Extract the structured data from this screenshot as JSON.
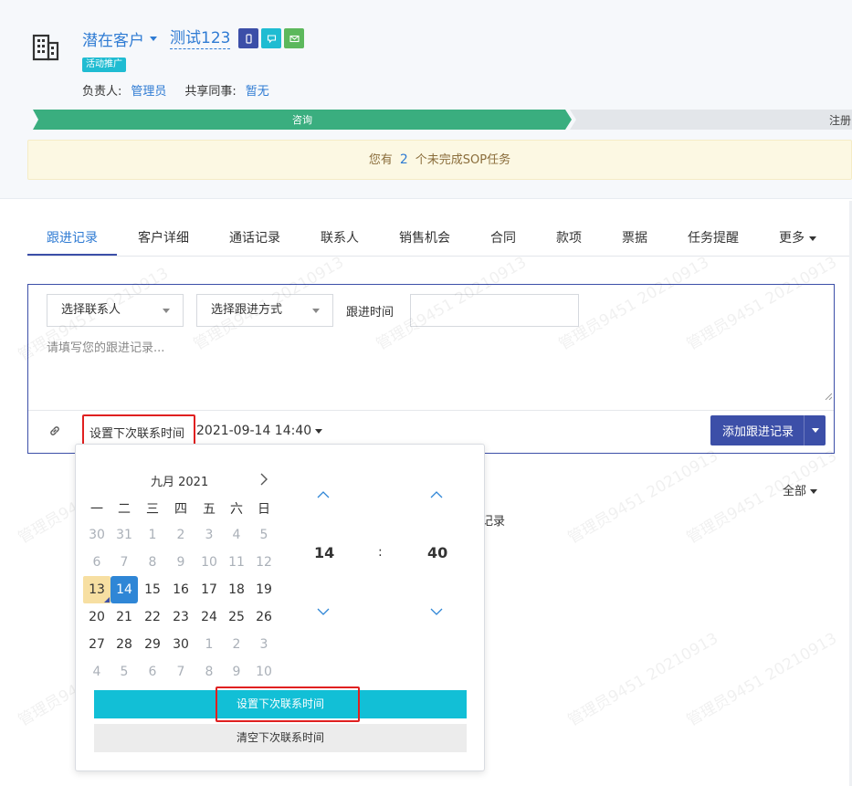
{
  "header": {
    "customer_type": "潜在客户",
    "customer_name": "测试123",
    "tag": "活动推广",
    "owner_label": "负责人:",
    "owner_value": "管理员",
    "share_label": "共享同事:",
    "share_value": "暂无",
    "stage_current": "咨询",
    "stage_next": "注册",
    "colors": {
      "stage_done": "#3aae7f",
      "stage_pending": "#e3e6ea",
      "call_btn": "#3c4fa8",
      "sms_btn": "#1fbcd2",
      "mail_btn": "#5cb85c"
    }
  },
  "sop": {
    "prefix": "您有",
    "count": "2",
    "suffix": "个未完成SOP任务"
  },
  "tabs": [
    "跟进记录",
    "客户详细",
    "通话记录",
    "联系人",
    "销售机会",
    "合同",
    "款项",
    "票据",
    "任务提醒",
    "更多"
  ],
  "follow": {
    "contact_select": "选择联系人",
    "method_select": "选择跟进方式",
    "time_label": "跟进时间",
    "time_value": "",
    "placeholder": "请填写您的跟进记录...",
    "next_time_label": "设置下次联系时间",
    "next_time_value": "2021-09-14 14:40",
    "add_button": "添加跟进记录"
  },
  "list": {
    "filter": "全部",
    "empty_text": "记录"
  },
  "datepicker": {
    "month_label": "九月 2021",
    "weekdays": [
      "一",
      "二",
      "三",
      "四",
      "五",
      "六",
      "日"
    ],
    "weeks": [
      [
        {
          "d": "30",
          "m": 1
        },
        {
          "d": "31",
          "m": 1
        },
        {
          "d": "1",
          "m": 1
        },
        {
          "d": "2",
          "m": 1
        },
        {
          "d": "3",
          "m": 1
        },
        {
          "d": "4",
          "m": 1
        },
        {
          "d": "5",
          "m": 1
        }
      ],
      [
        {
          "d": "6",
          "m": 1
        },
        {
          "d": "7",
          "m": 1
        },
        {
          "d": "8",
          "m": 1
        },
        {
          "d": "9",
          "m": 1
        },
        {
          "d": "10",
          "m": 1
        },
        {
          "d": "11",
          "m": 1
        },
        {
          "d": "12",
          "m": 1
        }
      ],
      [
        {
          "d": "13",
          "t": 1
        },
        {
          "d": "14",
          "s": 1
        },
        {
          "d": "15"
        },
        {
          "d": "16"
        },
        {
          "d": "17"
        },
        {
          "d": "18"
        },
        {
          "d": "19"
        }
      ],
      [
        {
          "d": "20"
        },
        {
          "d": "21"
        },
        {
          "d": "22"
        },
        {
          "d": "23"
        },
        {
          "d": "24"
        },
        {
          "d": "25"
        },
        {
          "d": "26"
        }
      ],
      [
        {
          "d": "27"
        },
        {
          "d": "28"
        },
        {
          "d": "29"
        },
        {
          "d": "30"
        },
        {
          "d": "1",
          "m": 1
        },
        {
          "d": "2",
          "m": 1
        },
        {
          "d": "3",
          "m": 1
        }
      ],
      [
        {
          "d": "4",
          "m": 1
        },
        {
          "d": "5",
          "m": 1
        },
        {
          "d": "6",
          "m": 1
        },
        {
          "d": "7",
          "m": 1
        },
        {
          "d": "8",
          "m": 1
        },
        {
          "d": "9",
          "m": 1
        },
        {
          "d": "10",
          "m": 1
        }
      ]
    ],
    "hour": "14",
    "colon": ":",
    "minute": "40",
    "set_button": "设置下次联系时间",
    "clear_button": "清空下次联系时间"
  },
  "watermark_text": "管理员9451 20210913"
}
